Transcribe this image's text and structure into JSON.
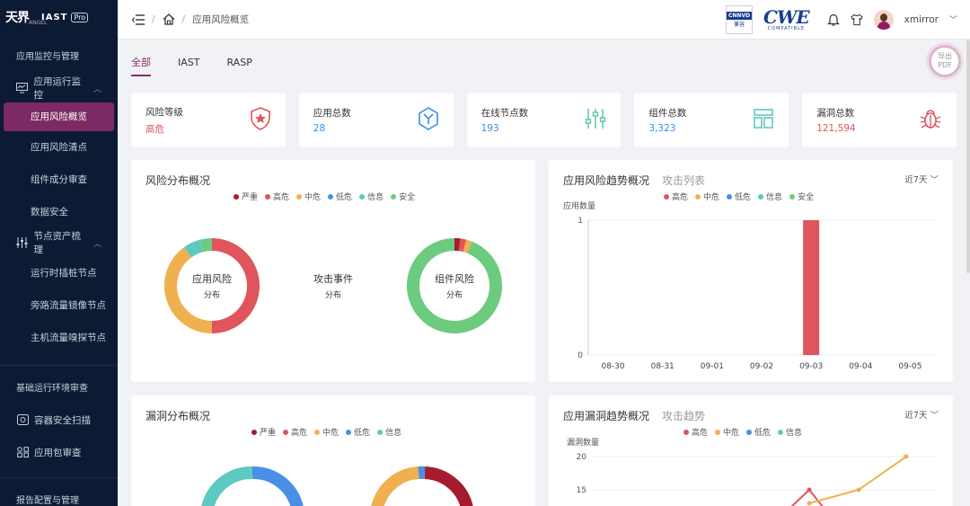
{
  "logo": {
    "mark": "天界",
    "sub": "ANGEL",
    "product": "IAST",
    "edition": "Pro"
  },
  "sidebar": {
    "groups": [
      {
        "label": "应用监控与管理"
      },
      {
        "label": "基础运行环境审查"
      },
      {
        "label": "报告配置与管理"
      }
    ],
    "parents": {
      "app_monitor": "应用运行监控",
      "node_assets": "节点资产梳理",
      "container_scan": "容器安全扫描",
      "package_audit": "应用包审查"
    },
    "items": {
      "risk_overview": "应用风险概览",
      "risk_list": "应用风险清点",
      "component_audit": "组件成分审查",
      "data_security": "数据安全",
      "runtime_nodes": "运行时插桩节点",
      "mirror_nodes": "旁路流量镜像节点",
      "host_probe_nodes": "主机流量嗅探节点"
    }
  },
  "topbar": {
    "breadcrumb": "应用风险概览",
    "cnnvd_title": "CNNVD",
    "cnnvd_sub": "兼容",
    "cwe_word": "CWE",
    "cwe_sub": "COMPATIBLE",
    "username": "xmirror"
  },
  "tabs": [
    "全部",
    "IAST",
    "RASP"
  ],
  "export": {
    "line1": "导出",
    "line2": "PDF"
  },
  "stats": [
    {
      "label": "风险等级",
      "value": "高危",
      "color": "#e0555b",
      "icon": "shield-star-icon"
    },
    {
      "label": "应用总数",
      "value": "28",
      "color": "#3a8ee6",
      "icon": "hexagon-y-icon"
    },
    {
      "label": "在线节点数",
      "value": "193",
      "color": "#3a8ee6",
      "icon": "sliders-icon"
    },
    {
      "label": "组件总数",
      "value": "3,323",
      "color": "#3a8ee6",
      "icon": "layout-icon"
    },
    {
      "label": "漏洞总数",
      "value": "121,594",
      "color": "#e0555b",
      "icon": "bug-icon"
    }
  ],
  "colors": {
    "critical": "#a61c2e",
    "high": "#e0555b",
    "medium": "#f0b050",
    "low": "#4a8fe6",
    "info": "#5ec9c0",
    "safe": "#6ccb7e",
    "accent": "#8e2a6b"
  },
  "risk_panel": {
    "title": "风险分布概况",
    "legend": [
      "严重",
      "高危",
      "中危",
      "低危",
      "信息",
      "安全"
    ],
    "donut_app": {
      "line1": "应用风险",
      "line2": "分布"
    },
    "attack_event": {
      "line1": "攻击事件",
      "line2": "分布"
    },
    "donut_component": {
      "line1": "组件风险",
      "line2": "分布"
    }
  },
  "trend_panel": {
    "title": "应用风险趋势概况",
    "sub": "攻击列表",
    "range": "近7天",
    "ylabel": "应用数量",
    "legend": [
      "高危",
      "中危",
      "低危",
      "信息",
      "安全"
    ]
  },
  "vuln_panel": {
    "title": "漏洞分布概况",
    "legend": [
      "严重",
      "高危",
      "中危",
      "低危",
      "信息"
    ]
  },
  "vuln_trend_panel": {
    "title": "应用漏洞趋势概况",
    "sub": "攻击趋势",
    "range": "近7天",
    "ylabel": "漏洞数量",
    "legend": [
      "高危",
      "中危",
      "低危",
      "信息"
    ]
  },
  "chart_data": [
    {
      "type": "pie",
      "name_hint": "app-risk-donut",
      "labels": [
        "高危",
        "中危",
        "信息",
        "安全"
      ],
      "values": [
        50,
        40,
        6,
        4
      ]
    },
    {
      "type": "pie",
      "name_hint": "component-risk-donut",
      "labels": [
        "严重",
        "高危",
        "中危",
        "安全"
      ],
      "values": [
        2,
        2,
        2,
        94
      ]
    },
    {
      "type": "bar",
      "categories": [
        "08-30",
        "08-31",
        "09-01",
        "09-02",
        "09-03",
        "09-04",
        "09-05"
      ],
      "series": [
        {
          "name": "高危",
          "values": [
            0,
            0,
            0,
            0,
            1,
            0,
            0
          ]
        }
      ],
      "ylabel": "应用数量",
      "ylim": [
        0,
        1
      ],
      "yticks": [
        "0",
        "1"
      ]
    },
    {
      "type": "line",
      "ylabel": "漏洞数量",
      "yticks": [
        "20",
        "15"
      ],
      "series": [
        {
          "name": "高危",
          "values": [
            15,
            12
          ]
        },
        {
          "name": "中危",
          "values": [
            13,
            14,
            15,
            20
          ]
        }
      ]
    }
  ]
}
